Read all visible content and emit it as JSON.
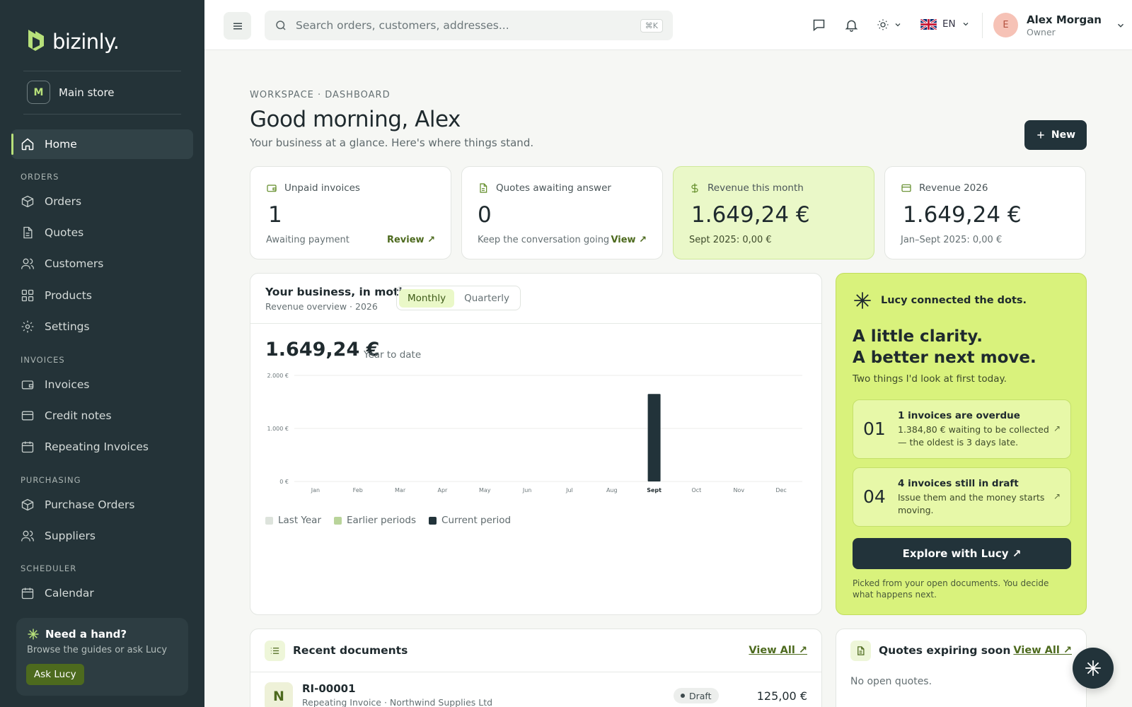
{
  "brand": {
    "name": "bizinly.",
    "accent": "#b7e07a",
    "dark": "#243338",
    "lucy_bg": "#d9f27c"
  },
  "store": {
    "badge": "M",
    "name": "Main store"
  },
  "sidebar": {
    "home": "Home",
    "sections": {
      "orders": "ORDERS",
      "invoices": "INVOICES",
      "purchasing": "PURCHASING",
      "scheduler": "SCHEDULER"
    },
    "items": {
      "orders": "Orders",
      "quotes": "Quotes",
      "customers": "Customers",
      "products": "Products",
      "settings": "Settings",
      "invoices": "Invoices",
      "credit_notes": "Credit notes",
      "repeating": "Repeating Invoices",
      "purchase_orders": "Purchase Orders",
      "suppliers": "Suppliers",
      "calendar": "Calendar"
    },
    "help": {
      "title": "Need a hand?",
      "subtitle": "Browse the guides or ask Lucy",
      "button": "Ask Lucy"
    }
  },
  "topbar": {
    "search_placeholder": "Search orders, customers, addresses...",
    "shortcut": "⌘K",
    "language": "EN",
    "user": {
      "initial": "E",
      "name": "Alex Morgan",
      "role": "Owner"
    }
  },
  "page": {
    "breadcrumb": "WORKSPACE · DASHBOARD",
    "title": "Good morning, Alex",
    "subtitle": "Your business at a glance. Here's where things stand.",
    "new_button": "New"
  },
  "kpis": [
    {
      "label": "Unpaid invoices",
      "value": "1",
      "sub": "Awaiting payment",
      "link": "Review ↗"
    },
    {
      "label": "Quotes awaiting answer",
      "value": "0",
      "sub": "Keep the conversation going",
      "link": "View ↗"
    },
    {
      "label": "Revenue this month",
      "value": "1.649,24 €",
      "sub": "Sept 2025: 0,00 €"
    },
    {
      "label": "Revenue 2026",
      "value": "1.649,24 €",
      "sub": "Jan–Sept 2025: 0,00 €"
    }
  ],
  "chart_card": {
    "title": "Your business, in motion",
    "subtitle": "Revenue overview · 2026",
    "tabs": [
      "Monthly",
      "Quarterly"
    ],
    "active_tab": "Monthly",
    "total": "1.649,24 €",
    "total_label": "Year to date"
  },
  "chart_data": {
    "type": "bar",
    "categories": [
      "Jan",
      "Feb",
      "Mar",
      "Apr",
      "May",
      "Jun",
      "Jul",
      "Aug",
      "Sept",
      "Oct",
      "Nov",
      "Dec"
    ],
    "series": [
      {
        "name": "Last Year",
        "color": "#dde3dc",
        "values": [
          0,
          0,
          0,
          0,
          0,
          0,
          0,
          0,
          0,
          0,
          0,
          0
        ]
      },
      {
        "name": "Earlier periods",
        "color": "#b9d49a",
        "values": [
          0,
          0,
          0,
          0,
          0,
          0,
          0,
          0,
          0,
          0,
          0,
          0
        ]
      },
      {
        "name": "Current period",
        "color": "#22333a",
        "values": [
          0,
          0,
          0,
          0,
          0,
          0,
          0,
          0,
          1649.24,
          0,
          0,
          0
        ]
      }
    ],
    "yticks": [
      "0 €",
      "1.000 €",
      "2.000 €"
    ],
    "ylim": [
      0,
      2000
    ],
    "highlight_category": "Sept",
    "grid": true,
    "legend": "bottom-left"
  },
  "lucy": {
    "header": "Lucy connected the dots.",
    "headline_1": "A little clarity.",
    "headline_2": "A better next move.",
    "subtitle": "Two things I'd look at first today.",
    "tips": [
      {
        "num": "01",
        "title": "1 invoices are overdue",
        "desc": "1.384,80 € waiting to be collected — the oldest is 3 days late."
      },
      {
        "num": "04",
        "title": "4 invoices still in draft",
        "desc": "Issue them and the money starts moving."
      }
    ],
    "cta": "Explore with Lucy ↗",
    "note": "Picked from your open documents. You decide what happens next."
  },
  "recent": {
    "title": "Recent documents",
    "view_all": "View All ↗",
    "rows": [
      {
        "avatar": "N",
        "id": "RI-00001",
        "desc": "Repeating Invoice · Northwind Supplies Ltd",
        "status": "Draft",
        "amount": "125,00 €"
      }
    ]
  },
  "quotes_expiring": {
    "title": "Quotes expiring soon",
    "view_all": "View All ↗",
    "empty": "No open quotes."
  }
}
